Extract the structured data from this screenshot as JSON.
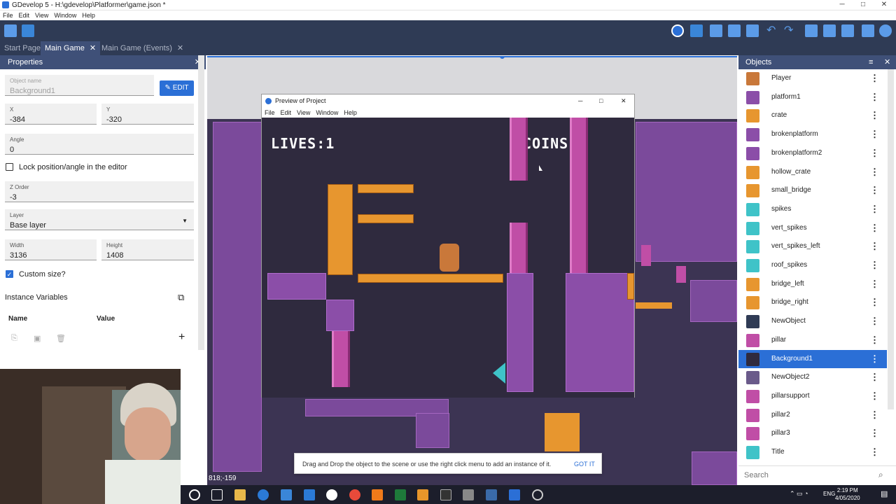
{
  "window": {
    "title": "GDevelop 5 - H:\\gdevelop\\Platformer\\game.json *",
    "minimize": "─",
    "maximize": "□",
    "close": "✕"
  },
  "menu": [
    "File",
    "Edit",
    "View",
    "Window",
    "Help"
  ],
  "tabs": [
    {
      "label": "Start Page"
    },
    {
      "label": "Main Game",
      "close": "✕"
    },
    {
      "label": "Main Game (Events)",
      "close": "✕"
    }
  ],
  "properties": {
    "title": "Properties",
    "close": "✕",
    "object_name_label": "Object name",
    "object_name": "Background1",
    "edit_label": "EDIT",
    "x_label": "X",
    "x_value": "-384",
    "y_label": "Y",
    "y_value": "-320",
    "angle_label": "Angle",
    "angle_value": "0",
    "lock_label": "Lock position/angle in the editor",
    "zorder_label": "Z Order",
    "zorder_value": "-3",
    "layer_label": "Layer",
    "layer_value": "Base layer",
    "width_label": "Width",
    "width_value": "3136",
    "height_label": "Height",
    "height_value": "1408",
    "custom_size_label": "Custom size?",
    "instance_vars_label": "Instance Variables",
    "col_name": "Name",
    "col_value": "Value",
    "add": "+"
  },
  "preview": {
    "title": "Preview of Project",
    "menu": [
      "File",
      "Edit",
      "View",
      "Window",
      "Help"
    ],
    "minimize": "─",
    "maximize": "□",
    "close": "✕",
    "lives": "LIVES:1",
    "coins": "COINS:0"
  },
  "objects": {
    "title": "Objects",
    "close": "✕",
    "search_placeholder": "Search",
    "items": [
      {
        "name": "Player",
        "color": "#c9783a"
      },
      {
        "name": "platform1",
        "color": "#8b4ea8"
      },
      {
        "name": "crate",
        "color": "#e7962f"
      },
      {
        "name": "brokenplatform",
        "color": "#8b4ea8"
      },
      {
        "name": "brokenplatform2",
        "color": "#8b4ea8"
      },
      {
        "name": "hollow_crate",
        "color": "#e7962f"
      },
      {
        "name": "small_bridge",
        "color": "#e7962f"
      },
      {
        "name": "spikes",
        "color": "#3fc3c8"
      },
      {
        "name": "vert_spikes",
        "color": "#3fc3c8"
      },
      {
        "name": "vert_spikes_left",
        "color": "#3fc3c8"
      },
      {
        "name": "roof_spikes",
        "color": "#3fc3c8"
      },
      {
        "name": "bridge_left",
        "color": "#e7962f"
      },
      {
        "name": "bridge_right",
        "color": "#e7962f"
      },
      {
        "name": "NewObject",
        "color": "#2f3b55"
      },
      {
        "name": "pillar",
        "color": "#c04ea6"
      },
      {
        "name": "Background1",
        "color": "#2f2a3e",
        "selected": true
      },
      {
        "name": "NewObject2",
        "color": "#6a5a8a"
      },
      {
        "name": "pillarsupport",
        "color": "#c04ea6"
      },
      {
        "name": "pillar2",
        "color": "#c04ea6"
      },
      {
        "name": "pillar3",
        "color": "#c04ea6"
      },
      {
        "name": "Title",
        "color": "#3fc3c8"
      }
    ]
  },
  "toast": {
    "message": "Drag and Drop the object to the scene or use the right click menu to add an instance of it.",
    "action": "GOT IT"
  },
  "scene": {
    "cursor_coords": "818;-159"
  },
  "taskbar": {
    "lang": "ENG",
    "time": "2:19 PM",
    "date": "4/05/2020"
  }
}
